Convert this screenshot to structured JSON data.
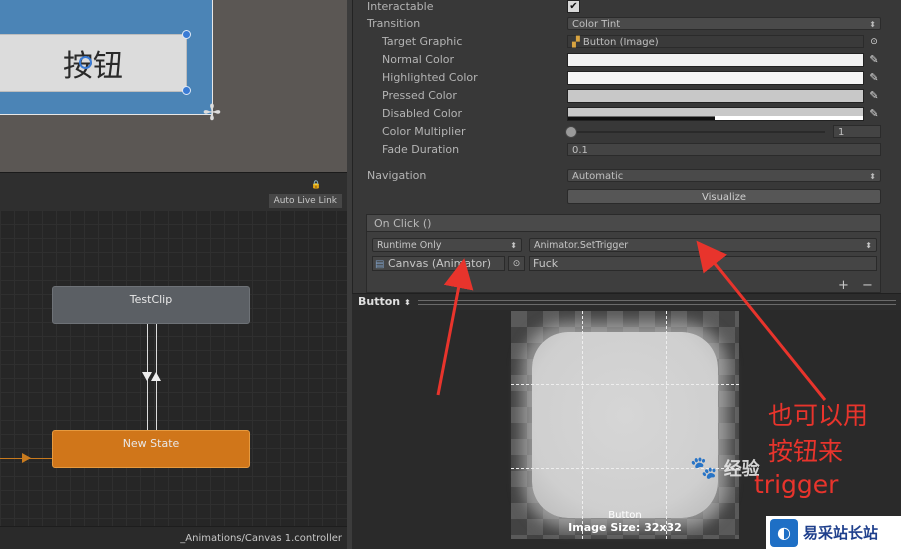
{
  "scene": {
    "button_text": "按钮"
  },
  "animator": {
    "auto_live_link": "Auto Live Link",
    "states": {
      "testclip": "TestClip",
      "new_state": "New State"
    },
    "controller_path": "_Animations/Canvas 1.controller"
  },
  "inspector": {
    "interactable_label": "Interactable",
    "interactable_check": "✔",
    "transition_label": "Transition",
    "transition_value": "Color Tint",
    "target_graphic_label": "Target Graphic",
    "target_graphic_value": "Button (Image)",
    "normal_color_label": "Normal Color",
    "highlighted_color_label": "Highlighted Color",
    "pressed_color_label": "Pressed Color",
    "disabled_color_label": "Disabled Color",
    "color_multiplier_label": "Color Multiplier",
    "color_multiplier_value": "1",
    "color_multiplier_fraction": 0.0,
    "fade_duration_label": "Fade Duration",
    "fade_duration_value": "0.1",
    "navigation_label": "Navigation",
    "navigation_value": "Automatic",
    "visualize_label": "Visualize",
    "onclick": {
      "header": "On Click ()",
      "runtime": "Runtime Only",
      "function": "Animator.SetTrigger",
      "object": "Canvas (Animator)",
      "argument": "Fuck",
      "add_label": "+",
      "remove_label": "−"
    }
  },
  "preview": {
    "title": "Button",
    "caption_name": "Button",
    "caption_size": "Image Size: 32x32"
  },
  "annotation": {
    "line1": "也可以用",
    "line2": "按钮来",
    "line3": "trigger",
    "color": "#e8342c"
  },
  "watermarks": {
    "site": "易采站长站",
    "jingyan": "经验"
  }
}
